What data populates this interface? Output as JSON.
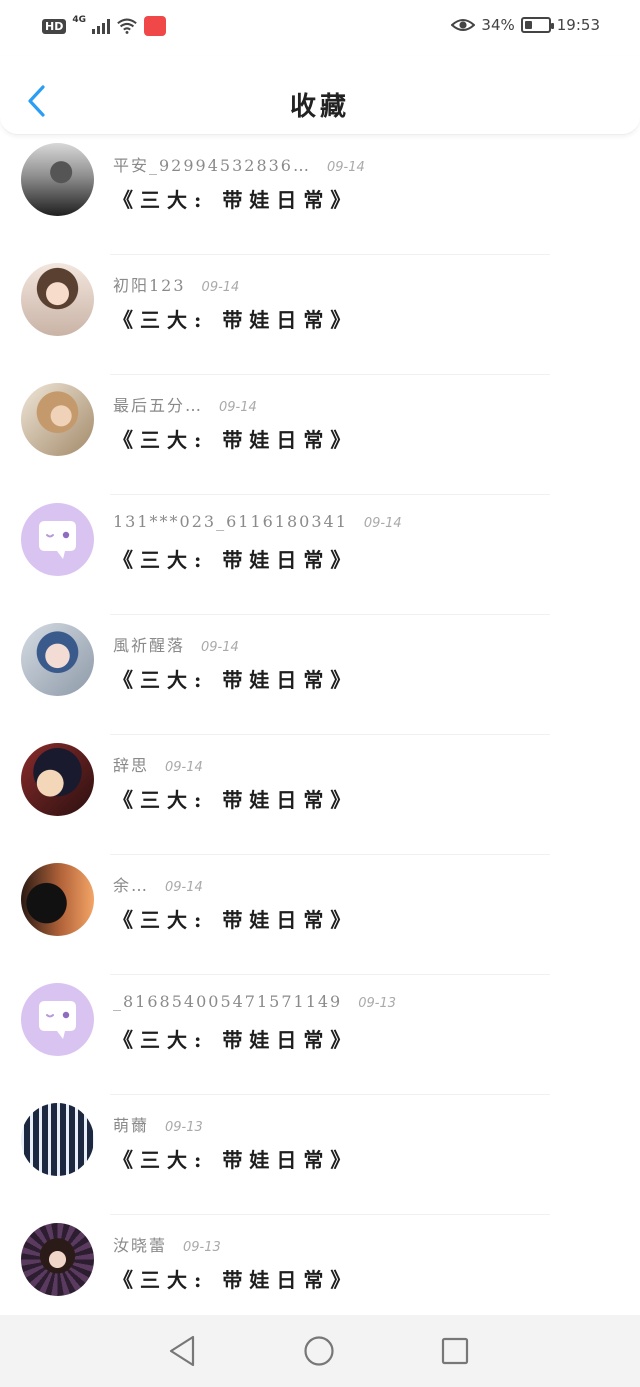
{
  "status_bar": {
    "hd": "HD",
    "network": "4G",
    "battery_text": "34%",
    "time": "19:53",
    "battery_level": 0.34
  },
  "header": {
    "title": "收藏",
    "back_icon": "chevron-left-icon"
  },
  "favorites": [
    {
      "username": "平安_92994532836…",
      "date": "09-14",
      "title": "《三大: 带娃日常》",
      "avatar": "photo"
    },
    {
      "username": "初阳123",
      "date": "09-14",
      "title": "《三大: 带娃日常》",
      "avatar": "photo"
    },
    {
      "username": "最后五分…",
      "date": "09-14",
      "title": "《三大: 带娃日常》",
      "avatar": "photo"
    },
    {
      "username": "131***023_6116180341",
      "date": "09-14",
      "title": "《三大: 带娃日常》",
      "avatar": "chat-bubble-icon"
    },
    {
      "username": "風祈醒落",
      "date": "09-14",
      "title": "《三大: 带娃日常》",
      "avatar": "photo"
    },
    {
      "username": "辞思",
      "date": "09-14",
      "title": "《三大: 带娃日常》",
      "avatar": "photo"
    },
    {
      "username": "余…",
      "date": "09-14",
      "title": "《三大: 带娃日常》",
      "avatar": "photo"
    },
    {
      "username": "_816854005471571149",
      "date": "09-13",
      "title": "《三大: 带娃日常》",
      "avatar": "chat-bubble-icon"
    },
    {
      "username": "萌薾",
      "date": "09-13",
      "title": "《三大: 带娃日常》",
      "avatar": "photo"
    },
    {
      "username": "汝晓蕾",
      "date": "09-13",
      "title": "《三大: 带娃日常》",
      "avatar": "photo"
    }
  ],
  "nav_bar": {
    "back": "triangle-back-icon",
    "home": "circle-home-icon",
    "recents": "square-recents-icon"
  },
  "colors": {
    "accent": "#2a9df4",
    "bot_avatar": "#d9c4f1",
    "nav_bg": "#f3f3f3"
  }
}
